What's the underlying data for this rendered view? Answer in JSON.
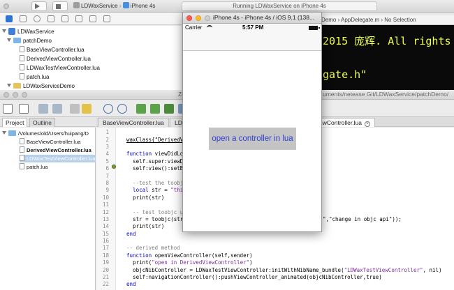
{
  "xcode": {
    "activity": "Running LDWaxService on iPhone 4s",
    "scheme_target": "LDWaxService",
    "scheme_device": "iPhone 4s",
    "jump_bar": [
      "Demo",
      "AppDelegate.m",
      "No Selection"
    ],
    "navigator": [
      {
        "label": "LDWaxService",
        "kind": "project"
      },
      {
        "label": "patchDemo",
        "kind": "folder"
      },
      {
        "label": "BaseViewController.lua",
        "kind": "file"
      },
      {
        "label": "DerivedViewController.lua",
        "kind": "file"
      },
      {
        "label": "LDWaxTestViewController.lua",
        "kind": "file"
      },
      {
        "label": "patch.lua",
        "kind": "file"
      },
      {
        "label": "LDWaxServiceDemo",
        "kind": "folder"
      }
    ],
    "dark_editor_lines": [
      "2015 庞辉. All rights",
      "gate.h\""
    ]
  },
  "zerobrane": {
    "title_fragment": "Ze",
    "path_fragment": "uments/netease Git/LDWaxService/patchDemo/",
    "panel_tabs": [
      "Project",
      "Outline"
    ],
    "tree": [
      {
        "label": "/Volumes/old/Users/huipang/D",
        "kind": "root"
      },
      {
        "label": "BaseViewController.lua",
        "kind": "file"
      },
      {
        "label": "DerivedViewController.lua",
        "kind": "file",
        "bold": true
      },
      {
        "label": "LDWaxTestViewController.lua",
        "kind": "file",
        "selected": true
      },
      {
        "label": "patch.lua",
        "kind": "file"
      }
    ],
    "editor_tabs": [
      "BaseViewController.lua",
      "LD",
      "ewController.lua"
    ],
    "line_numbers": [
      "1",
      "2",
      "3",
      "4",
      "5",
      "6",
      "7",
      "8",
      "9",
      "10",
      "11",
      "12",
      "13",
      "14",
      "15",
      "16",
      "17",
      "18",
      "19",
      "20",
      "21",
      "22"
    ],
    "code": {
      "l2": "waxClass{\"DerivedV",
      "l4a": "function",
      "l4b": " viewDidLo",
      "l5": "    self.super:viewD",
      "l6": "    self:view():setB",
      "l8": "    --test the toobj",
      "l9a": "    local",
      "l9b": " str = ",
      "l9c": "\"thi",
      "l10": "    print(str)",
      "l12": "    -- test toobjc u",
      "l13a": "    str = toobjc(str",
      "l13b": "\",\"change in objc api\"));",
      "l14": "    print(str)",
      "l15": "end",
      "l17": "-- derived method",
      "l18a": "function",
      "l18b": " openViewController(self,sender)",
      "l19a": "    print(",
      "l19b": "\"open in DerivedViewController\"",
      "l19c": ")",
      "l20a": "    objcNibController = LDWaxTestViewController:initWithNibName_bundle(",
      "l20b": "\"LDWaxTestViewController\"",
      "l20c": ", nil)",
      "l21": "    self:navigationController():pushViewController_animated(objcNibController,true)",
      "l22": "end"
    }
  },
  "simulator": {
    "title": "iPhone 4s - iPhone 4s / iOS 9.1 (138...",
    "carrier": "Carrier",
    "time": "5:57 PM",
    "button_label": "open a controller in lua"
  }
}
